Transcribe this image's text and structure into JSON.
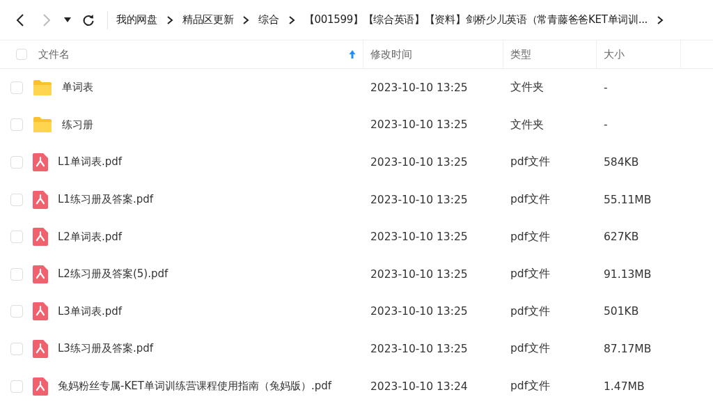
{
  "toolbar": {
    "back_disabled": false,
    "forward_disabled": true
  },
  "breadcrumb": [
    "我的网盘",
    "精品区更新",
    "综合",
    "【001599】【综合英语】【资料】剑桥少儿英语（常青藤爸爸KET单词训..."
  ],
  "table": {
    "select_all_checked": false,
    "columns": [
      {
        "label": "文件名",
        "sorted": true
      },
      {
        "label": "修改时间",
        "sorted": false
      },
      {
        "label": "类型",
        "sorted": false
      },
      {
        "label": "大小",
        "sorted": false
      }
    ],
    "rows": [
      {
        "kind": "folder",
        "checked": false,
        "name": "单词表",
        "modified": "2023-10-10 13:25",
        "type": "文件夹",
        "size": "-"
      },
      {
        "kind": "folder",
        "checked": false,
        "name": "练习册",
        "modified": "2023-10-10 13:25",
        "type": "文件夹",
        "size": "-"
      },
      {
        "kind": "pdf",
        "checked": false,
        "name": "L1单词表.pdf",
        "modified": "2023-10-10 13:25",
        "type": "pdf文件",
        "size": "584KB"
      },
      {
        "kind": "pdf",
        "checked": false,
        "name": "L1练习册及答案.pdf",
        "modified": "2023-10-10 13:25",
        "type": "pdf文件",
        "size": "55.11MB"
      },
      {
        "kind": "pdf",
        "checked": false,
        "name": "L2单词表.pdf",
        "modified": "2023-10-10 13:25",
        "type": "pdf文件",
        "size": "627KB"
      },
      {
        "kind": "pdf",
        "checked": false,
        "name": "L2练习册及答案(5).pdf",
        "modified": "2023-10-10 13:25",
        "type": "pdf文件",
        "size": "91.13MB"
      },
      {
        "kind": "pdf",
        "checked": false,
        "name": "L3单词表.pdf",
        "modified": "2023-10-10 13:25",
        "type": "pdf文件",
        "size": "501KB"
      },
      {
        "kind": "pdf",
        "checked": false,
        "name": "L3练习册及答案.pdf",
        "modified": "2023-10-10 13:25",
        "type": "pdf文件",
        "size": "87.17MB"
      },
      {
        "kind": "pdf",
        "checked": false,
        "name": "兔妈粉丝专属-KET单词训练营课程使用指南（兔妈版）.pdf",
        "modified": "2023-10-10 13:24",
        "type": "pdf文件",
        "size": "1.47MB"
      }
    ]
  }
}
